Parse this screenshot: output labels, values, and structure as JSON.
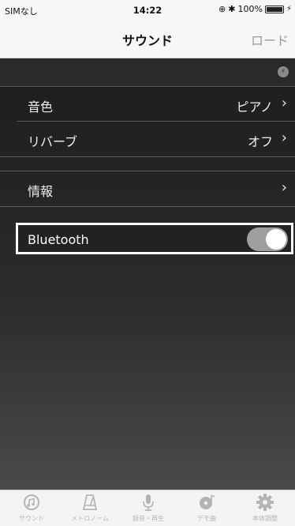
{
  "status": {
    "carrier": "SIMなし",
    "time": "14:22",
    "battery": "100%"
  },
  "nav": {
    "title": "サウンド",
    "load_label": "ロード"
  },
  "settings": {
    "tone": {
      "label": "音色",
      "value": "ピアノ"
    },
    "reverb": {
      "label": "リバーブ",
      "value": "オフ"
    },
    "info": {
      "label": "情報"
    },
    "bluetooth": {
      "label": "Bluetooth",
      "enabled": true
    }
  },
  "tabs": [
    {
      "label": "サウンド",
      "icon": "sound-icon"
    },
    {
      "label": "メトロノーム",
      "icon": "metronome-icon"
    },
    {
      "label": "録音・再生",
      "icon": "microphone-icon"
    },
    {
      "label": "デモ曲",
      "icon": "disc-note-icon"
    },
    {
      "label": "本体調整",
      "icon": "gear-icon"
    }
  ],
  "colors": {
    "background_dark": "#2a2a2a",
    "toggle_on": "#9e9e9e",
    "tab_inactive": "#b4b4b4"
  }
}
